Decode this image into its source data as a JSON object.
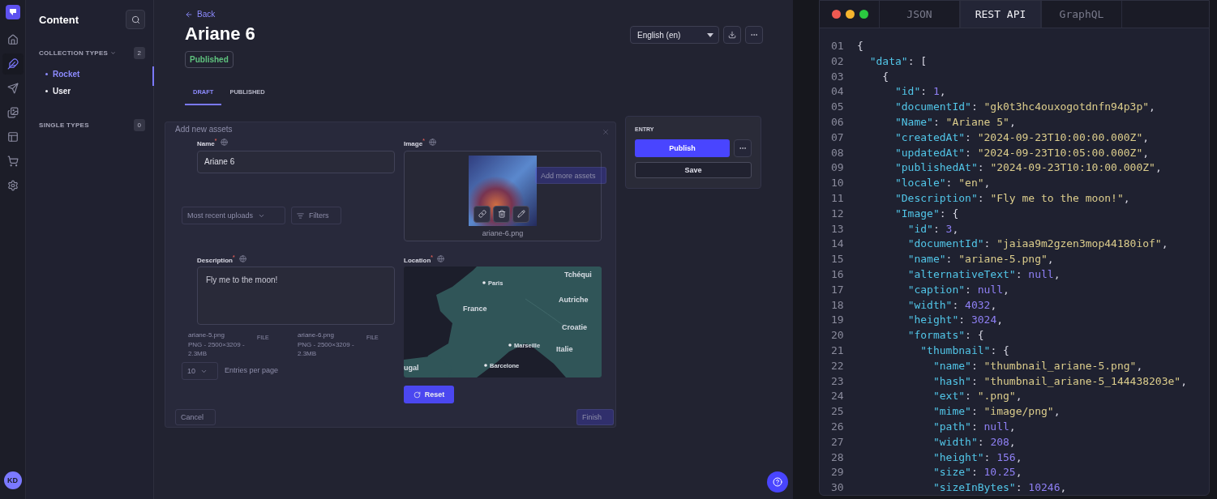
{
  "rail": {
    "items": [
      {
        "kind": "home",
        "selected": false
      },
      {
        "kind": "feather",
        "selected": true
      },
      {
        "kind": "send",
        "selected": false
      },
      {
        "kind": "images",
        "selected": false
      },
      {
        "kind": "layout",
        "selected": false
      },
      {
        "kind": "cart",
        "selected": false
      },
      {
        "kind": "settings",
        "selected": false
      }
    ],
    "avatar": "KD"
  },
  "sidebar": {
    "title": "Content",
    "sections": [
      {
        "label": "COLLECTION TYPES",
        "kind": "collapsible",
        "count": "2",
        "items": [
          {
            "label": "Rocket",
            "selected": true
          },
          {
            "label": "User",
            "selected": false
          }
        ]
      },
      {
        "label": "SINGLE TYPES",
        "kind": "plain",
        "count": "0"
      }
    ]
  },
  "header": {
    "back": "Back",
    "title": "Ariane 6",
    "status": "Published",
    "locale": "English (en)",
    "tabs": [
      {
        "label": "DRAFT",
        "selected": true
      },
      {
        "label": "PUBLISHED",
        "selected": false
      }
    ]
  },
  "form": {
    "name": {
      "label": "Name$^{*}$",
      "value": "Ariane 6"
    },
    "image": {
      "label": "Image$^{*}$",
      "file": "ariane-6.png"
    },
    "description": {
      "label": "Description$^{*}$",
      "value": "Fly me to the moon!"
    },
    "location": {
      "label": "Location$^{*}$",
      "reset": "Reset",
      "places": [
        {
          "label": "Tchéqui",
          "kind": "country"
        },
        {
          "label": "Paris",
          "kind": "city"
        },
        {
          "label": "Autriche",
          "kind": "country"
        },
        {
          "label": "France",
          "kind": "country"
        },
        {
          "label": "Croatie",
          "kind": "country"
        },
        {
          "label": "Marseille",
          "kind": "city"
        },
        {
          "label": "Italie",
          "kind": "country"
        },
        {
          "label": "ugal",
          "kind": "country"
        },
        {
          "label": "Barcelone",
          "kind": "city"
        }
      ]
    }
  },
  "entry": {
    "title": "ENTRY",
    "publish": "Publish",
    "save": "Save"
  },
  "ghost_modal": {
    "title": "Add new assets",
    "add_more": "Add more assets",
    "sort": "Most recent uploads",
    "filters": "Filters",
    "assets": [
      {
        "name": "ariane-5.png",
        "meta": "PNG - 2500×3209 - 2.3MB",
        "type": "FILE"
      },
      {
        "name": "ariane-6.png",
        "meta": "PNG - 2500×3209 - 2.3MB",
        "type": "FILE"
      }
    ],
    "page_size": "10",
    "page_size_label": "Entries per page",
    "cancel": "Cancel",
    "finish": "Finish"
  },
  "code_panel": {
    "tabs": [
      {
        "label": "JSON",
        "selected": false
      },
      {
        "label": "REST API",
        "selected": true
      },
      {
        "label": "GraphQL",
        "selected": false
      }
    ],
    "lines": [
      {
        "number": "01",
        "text": "{"
      },
      {
        "number": "02",
        "text": "  \"data\": ["
      },
      {
        "number": "03",
        "text": "    {"
      },
      {
        "number": "04",
        "text": "      \"id\": 1,"
      },
      {
        "number": "05",
        "text": "      \"documentId\": \"gk0t3hc4ouxogotdnfn94p3p\","
      },
      {
        "number": "06",
        "text": "      \"Name\": \"Ariane 5\","
      },
      {
        "number": "07",
        "text": "      \"createdAt\": \"2024-09-23T10:00:00.000Z\","
      },
      {
        "number": "08",
        "text": "      \"updatedAt\": \"2024-09-23T10:05:00.000Z\","
      },
      {
        "number": "09",
        "text": "      \"publishedAt\": \"2024-09-23T10:10:00.000Z\","
      },
      {
        "number": "10",
        "text": "      \"locale\": \"en\","
      },
      {
        "number": "11",
        "text": "      \"Description\": \"Fly me to the moon!\","
      },
      {
        "number": "12",
        "text": "      \"Image\": {"
      },
      {
        "number": "13",
        "text": "        \"id\": 3,"
      },
      {
        "number": "14",
        "text": "        \"documentId\": \"jaiaa9m2gzen3mop44180iof\","
      },
      {
        "number": "15",
        "text": "        \"name\": \"ariane-5.png\","
      },
      {
        "number": "16",
        "text": "        \"alternativeText\": null,"
      },
      {
        "number": "17",
        "text": "        \"caption\": null,"
      },
      {
        "number": "18",
        "text": "        \"width\": 4032,"
      },
      {
        "number": "19",
        "text": "        \"height\": 3024,"
      },
      {
        "number": "20",
        "text": "        \"formats\": {"
      },
      {
        "number": "21",
        "text": "          \"thumbnail\": {"
      },
      {
        "number": "22",
        "text": "            \"name\": \"thumbnail_ariane-5.png\","
      },
      {
        "number": "23",
        "text": "            \"hash\": \"thumbnail_ariane-5_144438203e\","
      },
      {
        "number": "24",
        "text": "            \"ext\": \".png\","
      },
      {
        "number": "25",
        "text": "            \"mime\": \"image/png\","
      },
      {
        "number": "26",
        "text": "            \"path\": null,"
      },
      {
        "number": "27",
        "text": "            \"width\": 208,"
      },
      {
        "number": "28",
        "text": "            \"height\": 156,"
      },
      {
        "number": "29",
        "text": "            \"size\": 10.25,"
      },
      {
        "number": "30",
        "text": "            \"sizeInBytes\": 10246,"
      }
    ]
  }
}
